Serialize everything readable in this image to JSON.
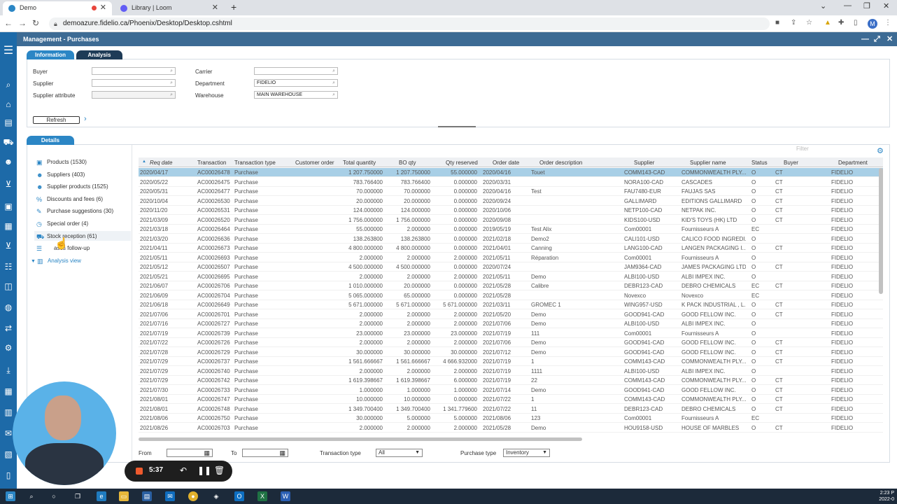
{
  "browser": {
    "tabs": [
      {
        "label": "Demo",
        "active": true
      },
      {
        "label": "Library | Loom",
        "active": false
      }
    ],
    "url": "demoazure.fidelio.ca/Phoenix/Desktop/Desktop.cshtml",
    "profile_initial": "M"
  },
  "app": {
    "title": "Management - Purchases",
    "tabs": [
      "Information",
      "Analysis"
    ],
    "filters": {
      "buyer_label": "Buyer",
      "supplier_label": "Supplier",
      "supplier_attribute_label": "Supplier attribute",
      "carrier_label": "Carrier",
      "department_label": "Department",
      "department_value": "FIDELIO",
      "warehouse_label": "Warehouse",
      "warehouse_value": "MAIN WAREHOUSE"
    },
    "refresh_label": "Refresh",
    "details_tab": "Details",
    "tree": [
      {
        "label": "Products (1530)",
        "icon": "box-icon"
      },
      {
        "label": "Suppliers (403)",
        "icon": "users-icon"
      },
      {
        "label": "Supplier products (1525)",
        "icon": "users-icon"
      },
      {
        "label": "Discounts and fees (6)",
        "icon": "percent-icon"
      },
      {
        "label": "Purchase suggestions (30)",
        "icon": "edit-icon"
      },
      {
        "label": "Special order (4)",
        "icon": "clock-icon"
      },
      {
        "label": "Stock reception (61)",
        "icon": "truck-icon"
      },
      {
        "label": "ases follow-up",
        "icon": "list-icon"
      },
      {
        "label": "Analysis view",
        "icon": "chart-icon"
      }
    ],
    "grid": {
      "filter_placeholder": "Filter",
      "columns": [
        "Req date",
        "Transaction",
        "Transaction type",
        "Customer order",
        "Total quantity",
        "BO qty",
        "Qty reserved",
        "Order date",
        "Order description",
        "Supplier",
        "Supplier name",
        "Status",
        "Buyer",
        "Department"
      ],
      "rows": [
        [
          "2020/04/17",
          "AC00026478",
          "Purchase",
          "",
          "1 207.750000",
          "1 207.750000",
          "55.000000",
          "2020/04/16",
          "Touet",
          "COMM143-CAD",
          "COMMONWEALTH PLY...",
          "O",
          "CT",
          "FIDELIO"
        ],
        [
          "2020/05/22",
          "AC00026475",
          "Purchase",
          "",
          "783.766400",
          "783.766400",
          "0.000000",
          "2020/03/31",
          "",
          "NORA100-CAD",
          "CASCADES",
          "O",
          "CT",
          "FIDELIO"
        ],
        [
          "2020/05/31",
          "AC00026477",
          "Purchase",
          "",
          "70.000000",
          "70.000000",
          "0.000000",
          "2020/04/16",
          "Test",
          "FAU7480-EUR",
          "FAUJAS SAS",
          "O",
          "CT",
          "FIDELIO"
        ],
        [
          "2020/10/04",
          "AC00026530",
          "Purchase",
          "",
          "20.000000",
          "20.000000",
          "0.000000",
          "2020/09/24",
          "",
          "GALLIMARD",
          "EDITIONS GALLIMARD",
          "O",
          "CT",
          "FIDELIO"
        ],
        [
          "2020/11/20",
          "AC00026531",
          "Purchase",
          "",
          "124.000000",
          "124.000000",
          "0.000000",
          "2020/10/06",
          "",
          "NETP100-CAD",
          "NETPAK INC.",
          "O",
          "CT",
          "FIDELIO"
        ],
        [
          "2021/03/09",
          "AC00026520",
          "Purchase",
          "",
          "1 756.000000",
          "1 756.000000",
          "0.000000",
          "2020/09/08",
          "",
          "KIDS100-USD",
          "KID'S TOYS (HK) LTD",
          "O",
          "CT",
          "FIDELIO"
        ],
        [
          "2021/03/18",
          "AC00026464",
          "Purchase",
          "",
          "55.000000",
          "2.000000",
          "0.000000",
          "2019/05/19",
          "Test Alix",
          "Com00001",
          "Fournisseurs A",
          "EC",
          "",
          "FIDELIO"
        ],
        [
          "2021/03/20",
          "AC00026636",
          "Purchase",
          "",
          "138.263800",
          "138.263800",
          "0.000000",
          "2021/02/18",
          "Demo2",
          "CALI101-USD",
          "CALICO FOOD INGREDI...",
          "O",
          "",
          "FIDELIO"
        ],
        [
          "2021/04/11",
          "AC00026673",
          "Purchase",
          "",
          "4 800.000000",
          "4 800.000000",
          "0.000000",
          "2021/04/01",
          "Canning",
          "LANG100-CAD",
          "LANGEN PACKAGING I...",
          "O",
          "CT",
          "FIDELIO"
        ],
        [
          "2021/05/11",
          "AC00026693",
          "Purchase",
          "",
          "2.000000",
          "2.000000",
          "2.000000",
          "2021/05/11",
          "Réparation",
          "Com00001",
          "Fournisseurs A",
          "O",
          "",
          "FIDELIO"
        ],
        [
          "2021/05/12",
          "AC00026507",
          "Purchase",
          "",
          "4 500.000000",
          "4 500.000000",
          "0.000000",
          "2020/07/24",
          "",
          "JAM9364-CAD",
          "JAMES PACKAGING LTD.",
          "O",
          "CT",
          "FIDELIO"
        ],
        [
          "2021/05/21",
          "AC00026695",
          "Purchase",
          "",
          "2.000000",
          "2.000000",
          "2.000000",
          "2021/05/11",
          "Demo",
          "ALBI100-USD",
          "ALBI IMPEX INC.",
          "O",
          "",
          "FIDELIO"
        ],
        [
          "2021/06/07",
          "AC00026706",
          "Purchase",
          "",
          "1 010.000000",
          "20.000000",
          "0.000000",
          "2021/05/28",
          "Calibre",
          "DEBR123-CAD",
          "DEBRO CHEMICALS",
          "EC",
          "CT",
          "FIDELIO"
        ],
        [
          "2021/06/09",
          "AC00026704",
          "Purchase",
          "",
          "5 065.000000",
          "65.000000",
          "0.000000",
          "2021/05/28",
          "",
          "Novexco",
          "Novexco",
          "EC",
          "",
          "FIDELIO"
        ],
        [
          "2021/06/18",
          "AC00026649",
          "Purchase",
          "",
          "5 671.000000",
          "5 671.000000",
          "5 671.000000",
          "2021/03/11",
          "GROMEC 1",
          "WING957-USD",
          "K PACK INDUSTRIAL , L...",
          "O",
          "CT",
          "FIDELIO"
        ],
        [
          "2021/07/06",
          "AC00026701",
          "Purchase",
          "",
          "2.000000",
          "2.000000",
          "2.000000",
          "2021/05/20",
          "Demo",
          "GOOD941-CAD",
          "GOOD FELLOW INC.",
          "O",
          "CT",
          "FIDELIO"
        ],
        [
          "2021/07/16",
          "AC00026727",
          "Purchase",
          "",
          "2.000000",
          "2.000000",
          "2.000000",
          "2021/07/06",
          "Demo",
          "ALBI100-USD",
          "ALBI IMPEX INC.",
          "O",
          "",
          "FIDELIO"
        ],
        [
          "2021/07/19",
          "AC00026739",
          "Purchase",
          "",
          "23.000000",
          "23.000000",
          "23.000000",
          "2021/07/19",
          "111",
          "Com00001",
          "Fournisseurs A",
          "O",
          "",
          "FIDELIO"
        ],
        [
          "2021/07/22",
          "AC00026726",
          "Purchase",
          "",
          "2.000000",
          "2.000000",
          "2.000000",
          "2021/07/06",
          "Demo",
          "GOOD941-CAD",
          "GOOD FELLOW INC.",
          "O",
          "CT",
          "FIDELIO"
        ],
        [
          "2021/07/28",
          "AC00026729",
          "Purchase",
          "",
          "30.000000",
          "30.000000",
          "30.000000",
          "2021/07/12",
          "Demo",
          "GOOD941-CAD",
          "GOOD FELLOW INC.",
          "O",
          "CT",
          "FIDELIO"
        ],
        [
          "2021/07/29",
          "AC00026737",
          "Purchase",
          "",
          "1 561.666667",
          "1 561.666667",
          "4 666.932000",
          "2021/07/19",
          "1",
          "COMM143-CAD",
          "COMMONWEALTH PLY...",
          "O",
          "CT",
          "FIDELIO"
        ],
        [
          "2021/07/29",
          "AC00026740",
          "Purchase",
          "",
          "2.000000",
          "2.000000",
          "2.000000",
          "2021/07/19",
          "1111",
          "ALBI100-USD",
          "ALBI IMPEX INC.",
          "O",
          "",
          "FIDELIO"
        ],
        [
          "2021/07/29",
          "AC00026742",
          "Purchase",
          "",
          "1 619.398667",
          "1 619.398667",
          "6.000000",
          "2021/07/19",
          "22",
          "COMM143-CAD",
          "COMMONWEALTH PLY...",
          "O",
          "CT",
          "FIDELIO"
        ],
        [
          "2021/07/30",
          "AC00026733",
          "Purchase",
          "",
          "1.000000",
          "1.000000",
          "1.000000",
          "2021/07/14",
          "Demo",
          "GOOD941-CAD",
          "GOOD FELLOW INC.",
          "O",
          "CT",
          "FIDELIO"
        ],
        [
          "2021/08/01",
          "AC00026747",
          "Purchase",
          "",
          "10.000000",
          "10.000000",
          "0.000000",
          "2021/07/22",
          "1",
          "COMM143-CAD",
          "COMMONWEALTH PLY...",
          "O",
          "CT",
          "FIDELIO"
        ],
        [
          "2021/08/01",
          "AC00026748",
          "Purchase",
          "",
          "1 349.700400",
          "1 349.700400",
          "1 341.779600",
          "2021/07/22",
          "11",
          "DEBR123-CAD",
          "DEBRO CHEMICALS",
          "O",
          "CT",
          "FIDELIO"
        ],
        [
          "2021/08/06",
          "AC00026750",
          "Purchase",
          "",
          "30.000000",
          "5.000000",
          "5.000000",
          "2021/08/06",
          "123",
          "Com00001",
          "Fournisseurs A",
          "EC",
          "",
          "FIDELIO"
        ],
        [
          "2021/08/26",
          "AC00026703",
          "Purchase",
          "",
          "2.000000",
          "2.000000",
          "2.000000",
          "2021/05/28",
          "Demo",
          "HOU9158-USD",
          "HOUSE OF MARBLES",
          "O",
          "CT",
          "FIDELIO"
        ]
      ]
    },
    "footer": {
      "from_label": "From",
      "to_label": "To",
      "transaction_type_label": "Transaction type",
      "transaction_type_value": "All",
      "purchase_type_label": "Purchase type",
      "purchase_type_value": "Inventory"
    }
  },
  "recorder": {
    "time": "5:37"
  },
  "taskbar": {
    "clock_time": "2:23 P",
    "clock_date": "2022-0"
  },
  "colors": {
    "app_sidebar": "#1d6aa8",
    "title_bar": "#3d6b94",
    "accent": "#2b86c5",
    "selected_row": "#a8cfe6"
  }
}
